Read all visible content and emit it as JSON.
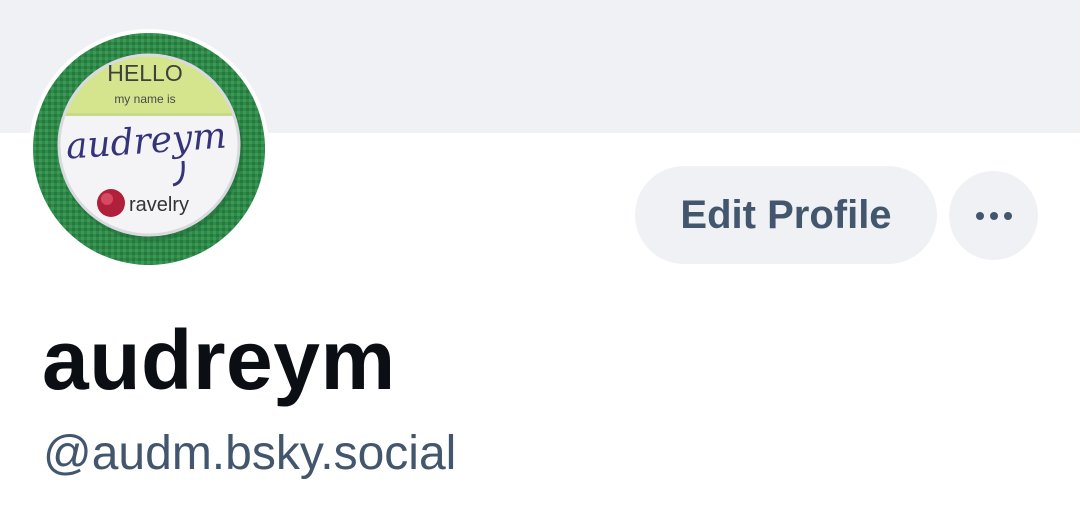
{
  "profile": {
    "display_name": "audreym",
    "handle": "@audm.bsky.social",
    "avatar": {
      "badge_hello": "HELLO",
      "badge_my_name_is": "my name is",
      "badge_name": "audreym",
      "badge_brand": "ravelry",
      "icon": "name-badge-avatar"
    }
  },
  "actions": {
    "edit_profile_label": "Edit Profile",
    "more_icon": "ellipsis-icon"
  },
  "colors": {
    "banner": "#eff1f4",
    "button_bg": "#eff1f4",
    "button_text": "#42566e",
    "name_text": "#0b0f14",
    "handle_text": "#42566e"
  }
}
